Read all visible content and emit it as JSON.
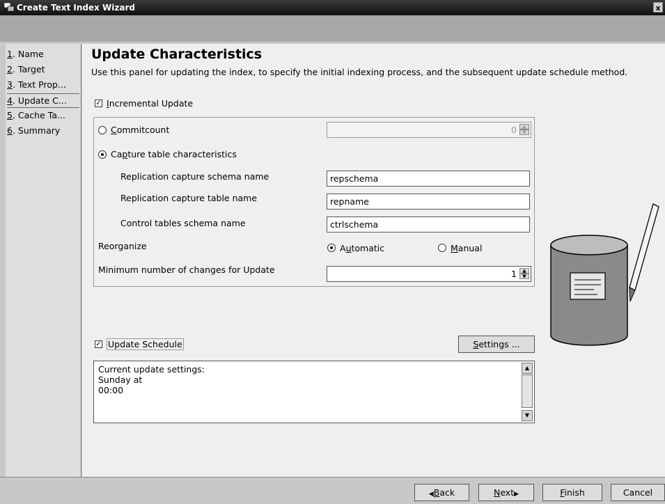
{
  "window": {
    "title": "Create Text Index Wizard",
    "close_glyph": "x"
  },
  "sidebar": {
    "items": [
      {
        "num": "1",
        "label": ". Name"
      },
      {
        "num": "2",
        "label": ". Target"
      },
      {
        "num": "3",
        "label": ". Text Prop..."
      },
      {
        "num": "4",
        "label": ". Update C..."
      },
      {
        "num": "5",
        "label": ". Cache Ta..."
      },
      {
        "num": "6",
        "label": ". Summary"
      }
    ],
    "selected_index": 3
  },
  "main": {
    "title": "Update Characteristics",
    "description": "Use this panel for updating the index, to specify the initial indexing process, and the subsequent update schedule method.",
    "incremental_update": {
      "pre": "",
      "mnemonic": "I",
      "post": "ncremental Update",
      "checked": true
    },
    "commitcount": {
      "pre": "",
      "mnemonic": "C",
      "post": "ommitcount",
      "selected": false,
      "value": "0"
    },
    "capture": {
      "pre": "Ca",
      "mnemonic": "p",
      "post": "ture table characteristics",
      "selected": true
    },
    "rep_schema": {
      "label": "Replication capture schema name",
      "value": "repschema"
    },
    "rep_table": {
      "label": "Replication capture table name",
      "value": "repname"
    },
    "ctrl_schema": {
      "label": "Control tables schema name",
      "value": "ctrlschema"
    },
    "reorganize": {
      "label": "Reorganize",
      "automatic": {
        "pre": "A",
        "mnemonic": "u",
        "post": "tomatic",
        "selected": true
      },
      "manual": {
        "pre": "",
        "mnemonic": "M",
        "post": "anual",
        "selected": false
      }
    },
    "min_changes": {
      "label": "Minimum number of changes for Update",
      "value": "1"
    },
    "update_schedule": {
      "label": "Update Schedule",
      "checked": true
    },
    "settings_button": {
      "mnemonic": "S",
      "post": "ettings ..."
    },
    "schedule_text": "Current update settings:\nSunday at\n00:00"
  },
  "footer": {
    "back": {
      "arrow": "◀",
      "mnemonic": "B",
      "post": "ack"
    },
    "next": {
      "pre": "",
      "mnemonic": "N",
      "post": "ext",
      "arrow": "▶"
    },
    "finish": {
      "mnemonic": "F",
      "post": "inish"
    },
    "cancel": {
      "label": "Cancel"
    }
  },
  "colors": {
    "title_bar": "#1a1a1a",
    "band": "#a8a8a8",
    "panel": "#efefef",
    "sidebar": "#dedede"
  },
  "icons": {
    "wizard": "wizard-window-icon",
    "illustration": "database-pencil-icon"
  }
}
